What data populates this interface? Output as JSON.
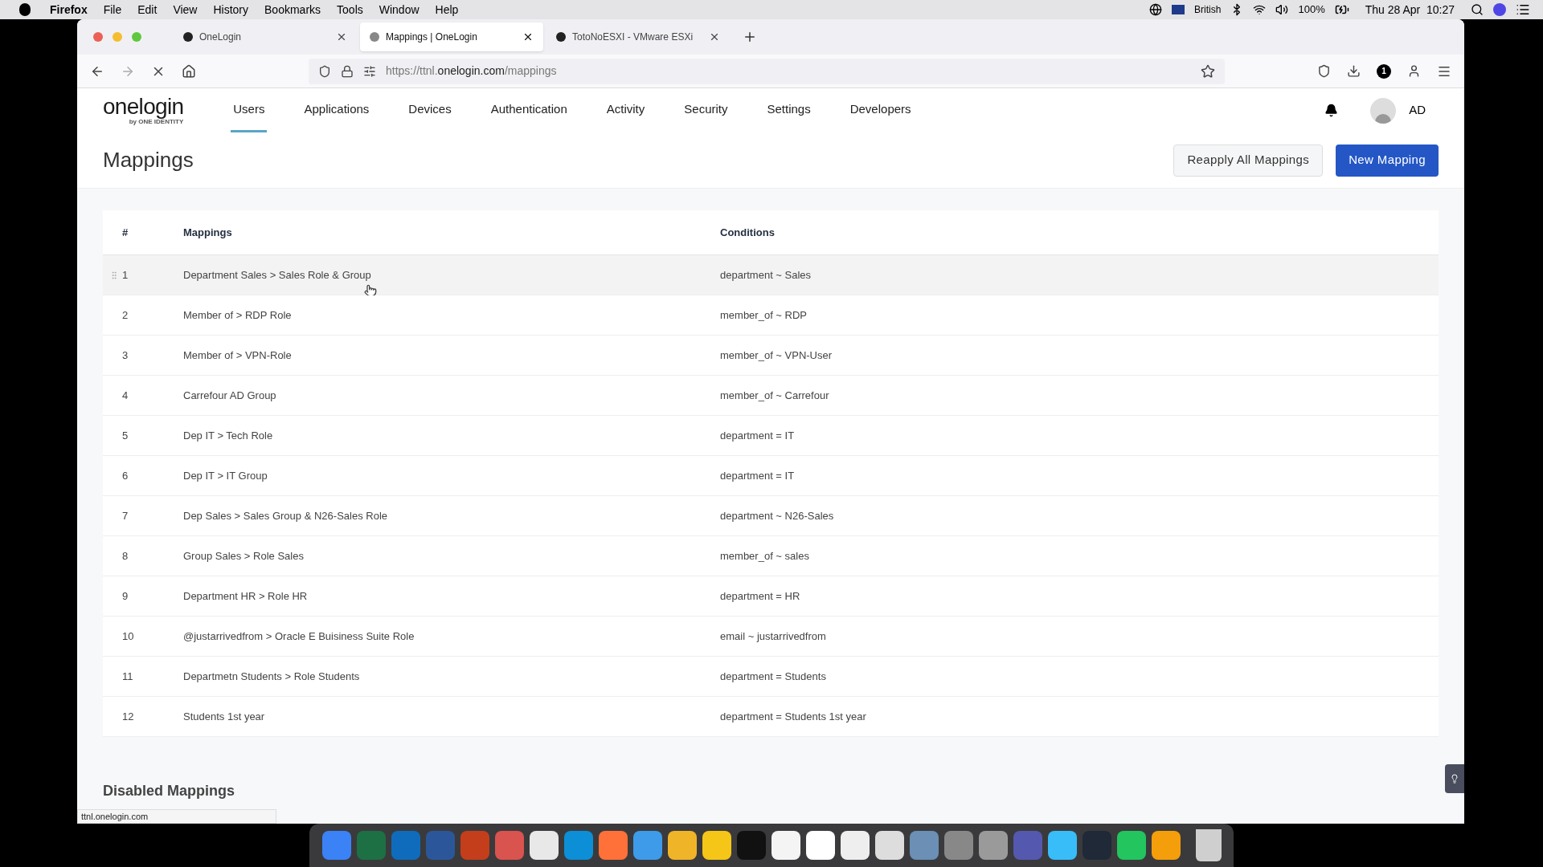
{
  "menu_bar": {
    "app": "Firefox",
    "menus": [
      "File",
      "Edit",
      "View",
      "History",
      "Bookmarks",
      "Tools",
      "Window",
      "Help"
    ],
    "keyboard": "British",
    "battery": "100%",
    "clock": "Thu 28 Apr  10:27"
  },
  "tabs": [
    {
      "title": "OneLogin",
      "selected": false
    },
    {
      "title": "Mappings | OneLogin",
      "selected": true
    },
    {
      "title": "TotoNoESXI - VMware ESXi",
      "selected": false
    }
  ],
  "address_bar": {
    "url": "https://ttnl.**onelogin.com**/mappings",
    "extension_badge": "1"
  },
  "nav": {
    "logo": "onelogin",
    "logo_sub": "by ONE IDENTITY",
    "items": [
      {
        "label": "Users",
        "selected": true
      },
      {
        "label": "Applications",
        "selected": false
      },
      {
        "label": "Devices",
        "selected": false
      },
      {
        "label": "Authentication",
        "selected": false
      },
      {
        "label": "Activity",
        "selected": false
      },
      {
        "label": "Security",
        "selected": false
      },
      {
        "label": "Settings",
        "selected": false
      },
      {
        "label": "Developers",
        "selected": false
      }
    ],
    "user": "AD"
  },
  "page": {
    "title": "Mappings",
    "buttons": [
      {
        "label": "Reapply All Mappings",
        "kind": "secondary"
      },
      {
        "label": "New Mapping",
        "kind": "primary"
      }
    ]
  },
  "table": {
    "columns": [
      "#",
      "Mappings",
      "Conditions"
    ],
    "rows": [
      {
        "number": "1",
        "mapping": "Department Sales > Sales Role & Group",
        "condition": "department ~ Sales",
        "highlighted": true
      },
      {
        "number": "2",
        "mapping": "Member of > RDP Role",
        "condition": "member_of ~ RDP",
        "highlighted": false
      },
      {
        "number": "3",
        "mapping": "Member of > VPN-Role",
        "condition": "member_of ~ VPN-User",
        "highlighted": false
      },
      {
        "number": "4",
        "mapping": "Carrefour AD Group",
        "condition": "member_of ~ Carrefour",
        "highlighted": false
      },
      {
        "number": "5",
        "mapping": "Dep IT > Tech Role",
        "condition": "department = IT",
        "highlighted": false
      },
      {
        "number": "6",
        "mapping": "Dep IT > IT Group",
        "condition": "department = IT",
        "highlighted": false
      },
      {
        "number": "7",
        "mapping": "Dep Sales > Sales Group & N26-Sales Role",
        "condition": "department ~ N26-Sales",
        "highlighted": false
      },
      {
        "number": "8",
        "mapping": "Group Sales > Role Sales",
        "condition": "member_of ~ sales",
        "highlighted": false
      },
      {
        "number": "9",
        "mapping": "Department HR > Role HR",
        "condition": "department = HR",
        "highlighted": false
      },
      {
        "number": "10",
        "mapping": "@justarrivedfrom > Oracle E Buisiness Suite Role",
        "condition": "email ~ justarrivedfrom",
        "highlighted": false
      },
      {
        "number": "11",
        "mapping": "Departmetn Students > Role Students",
        "condition": "department = Students",
        "highlighted": false
      },
      {
        "number": "12",
        "mapping": "Students 1st year",
        "condition": "department = Students 1st year",
        "highlighted": false
      }
    ]
  },
  "disabled_section": {
    "title": "Disabled Mappings"
  },
  "status_url": "ttnl.onelogin.com"
}
